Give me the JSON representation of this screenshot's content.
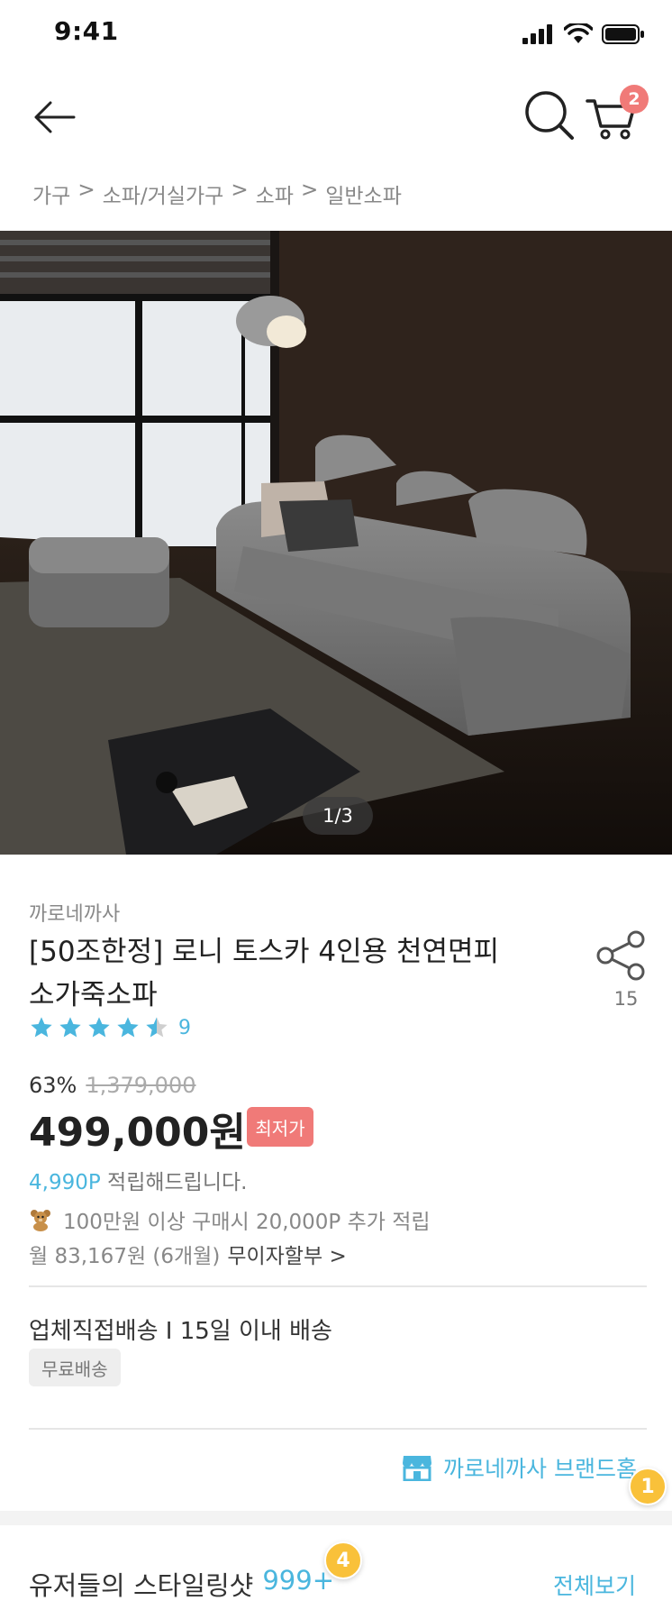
{
  "status_bar": {
    "time": "9:41"
  },
  "nav": {
    "cart_count": "2"
  },
  "breadcrumb": {
    "items": [
      "가구",
      ">",
      "소파/거실가구",
      ">",
      "소파",
      ">",
      "일반소파"
    ]
  },
  "gallery": {
    "counter": "1/3"
  },
  "product": {
    "brand": "까로네까사",
    "title": "[50조한정] 로니 토스카 4인용 천연면피 소가죽소파",
    "share_count": "15",
    "rating_value": 4.5,
    "review_count": "9",
    "discount_rate": "63%",
    "original_price": "1,379,000",
    "sale_price": "499,000원",
    "lowest_badge": "최저가",
    "points_value": "4,990P",
    "points_text": "적립해드립니다.",
    "promo_text": "100만원 이상 구매시 20,000P 추가 적립",
    "installment_text": "월 83,167원 (6개월)",
    "installment_link": "무이자할부 >"
  },
  "delivery": {
    "info": "업체직접배송 I 15일 이내 배송",
    "tag": "무료배송"
  },
  "brand_home": {
    "label": "까로네까사 브랜드홈"
  },
  "badges": {
    "brand_home_badge": "1",
    "styling_badge": "4"
  },
  "styling": {
    "title": "유저들의 스타일링샷",
    "count": "999+",
    "view_all": "전체보기"
  },
  "colors": {
    "accent": "#4ab6de",
    "badge": "#f07a78",
    "notify": "#f9c13a"
  },
  "icons": [
    "back-arrow-icon",
    "search-icon",
    "cart-icon",
    "share-icon",
    "star-icon",
    "teddy-bear-icon",
    "store-icon"
  ]
}
